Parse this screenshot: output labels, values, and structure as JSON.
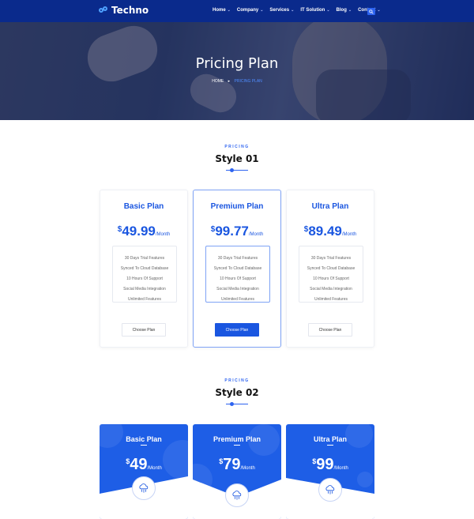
{
  "brand": {
    "name": "Techno"
  },
  "nav": {
    "items": [
      {
        "label": "Home"
      },
      {
        "label": "Company"
      },
      {
        "label": "Services"
      },
      {
        "label": "IT Solution"
      },
      {
        "label": "Blog"
      },
      {
        "label": "Contact"
      }
    ]
  },
  "hero": {
    "title": "Pricing Plan",
    "breadcrumb": {
      "home": "HOME",
      "current": "PRICING PLAN"
    }
  },
  "style1": {
    "tag": "PRICING",
    "title": "Style 01",
    "plans": [
      {
        "name": "Basic Plan",
        "currency": "$",
        "amount": "49.99",
        "period": "/Month",
        "button": "Choose Plan",
        "features": [
          "30 Days Trial Features",
          "Synced To Cloud Database",
          "10 Hours Of Support",
          "Social Media Integration",
          "Unlimited Features"
        ]
      },
      {
        "name": "Premium Plan",
        "currency": "$",
        "amount": "99.77",
        "period": "/Month",
        "button": "Choose Plan",
        "features": [
          "30 Days Trial Features",
          "Synced To Cloud Database",
          "10 Hours Of Support",
          "Social Media Integration",
          "Unlimited Features"
        ]
      },
      {
        "name": "Ultra Plan",
        "currency": "$",
        "amount": "89.49",
        "period": "/Month",
        "button": "Choose Plan",
        "features": [
          "30 Days Trial Features",
          "Synced To Cloud Database",
          "10 Hours Of Support",
          "Social Media Integration",
          "Unlimited Features"
        ]
      }
    ]
  },
  "style2": {
    "tag": "PRICING",
    "title": "Style 02",
    "plans": [
      {
        "name": "Basic Plan",
        "currency": "$",
        "amount": "49",
        "period": "/Month"
      },
      {
        "name": "Premium Plan",
        "currency": "$",
        "amount": "79",
        "period": "/Month"
      },
      {
        "name": "Ultra Plan",
        "currency": "$",
        "amount": "99",
        "period": "/Month"
      }
    ]
  },
  "colors": {
    "nav_bg": "#0a2a8c",
    "accent": "#1a56e0",
    "card_blue": "#1e5ee6"
  },
  "icons": [
    "search-icon",
    "cloud-icon",
    "chevron-down-icon",
    "logo-icon"
  ]
}
